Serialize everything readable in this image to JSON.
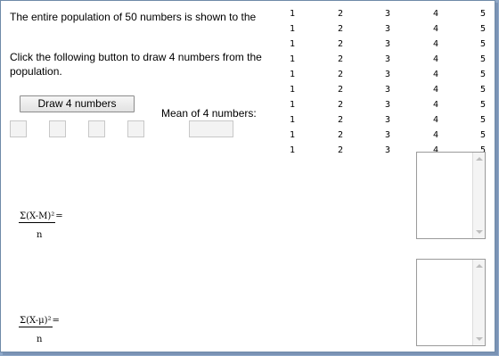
{
  "intro": {
    "line1": "The entire population of 50 numbers is shown to the",
    "line2": "Click the following button to draw 4 numbers from the",
    "line3": "population."
  },
  "draw_button": "Draw 4 numbers",
  "mean_label": "Mean of 4 numbers:",
  "population": {
    "rows": [
      [
        "1",
        "2",
        "3",
        "4",
        "5"
      ],
      [
        "1",
        "2",
        "3",
        "4",
        "5"
      ],
      [
        "1",
        "2",
        "3",
        "4",
        "5"
      ],
      [
        "1",
        "2",
        "3",
        "4",
        "5"
      ],
      [
        "1",
        "2",
        "3",
        "4",
        "5"
      ],
      [
        "1",
        "2",
        "3",
        "4",
        "5"
      ],
      [
        "1",
        "2",
        "3",
        "4",
        "5"
      ],
      [
        "1",
        "2",
        "3",
        "4",
        "5"
      ],
      [
        "1",
        "2",
        "3",
        "4",
        "5"
      ],
      [
        "1",
        "2",
        "3",
        "4",
        "5"
      ]
    ]
  },
  "formula1": {
    "numerator": "Σ(X-M)²",
    "denominator": "n",
    "equals": "="
  },
  "formula2": {
    "numerator": "Σ(X-μ)²",
    "denominator": "n",
    "equals": "="
  }
}
